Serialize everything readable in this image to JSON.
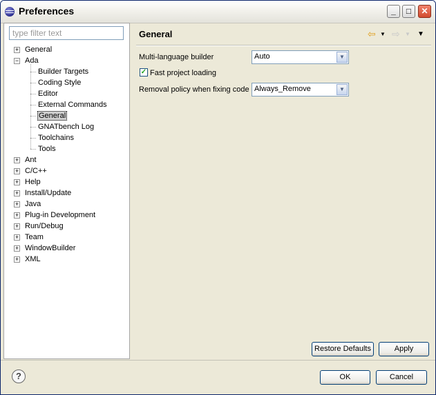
{
  "window": {
    "title": "Preferences"
  },
  "filter": {
    "placeholder": "type filter text"
  },
  "tree": [
    {
      "label": "General",
      "level": 0,
      "expander": "+"
    },
    {
      "label": "Ada",
      "level": 0,
      "expander": "-"
    },
    {
      "label": "Builder Targets",
      "level": 1
    },
    {
      "label": "Coding Style",
      "level": 1
    },
    {
      "label": "Editor",
      "level": 1
    },
    {
      "label": "External Commands",
      "level": 1
    },
    {
      "label": "General",
      "level": 1,
      "selected": true
    },
    {
      "label": "GNATbench Log",
      "level": 1
    },
    {
      "label": "Toolchains",
      "level": 1
    },
    {
      "label": "Tools",
      "level": 1
    },
    {
      "label": "Ant",
      "level": 0,
      "expander": "+"
    },
    {
      "label": "C/C++",
      "level": 0,
      "expander": "+"
    },
    {
      "label": "Help",
      "level": 0,
      "expander": "+"
    },
    {
      "label": "Install/Update",
      "level": 0,
      "expander": "+"
    },
    {
      "label": "Java",
      "level": 0,
      "expander": "+"
    },
    {
      "label": "Plug-in Development",
      "level": 0,
      "expander": "+"
    },
    {
      "label": "Run/Debug",
      "level": 0,
      "expander": "+"
    },
    {
      "label": "Team",
      "level": 0,
      "expander": "+"
    },
    {
      "label": "WindowBuilder",
      "level": 0,
      "expander": "+"
    },
    {
      "label": "XML",
      "level": 0,
      "expander": "+"
    }
  ],
  "panel": {
    "title": "General",
    "multi_language_label": "Multi-language builder",
    "multi_language_value": "Auto",
    "fast_loading_label": "Fast project loading",
    "fast_loading_checked": true,
    "removal_label": "Removal policy when fixing code",
    "removal_value": "Always_Remove"
  },
  "buttons": {
    "restore_defaults": "Restore Defaults",
    "apply": "Apply",
    "ok": "OK",
    "cancel": "Cancel"
  },
  "icons": {
    "back": "back-arrow-icon",
    "forward": "forward-arrow-icon",
    "menu": "view-menu-icon",
    "help": "help-icon"
  }
}
